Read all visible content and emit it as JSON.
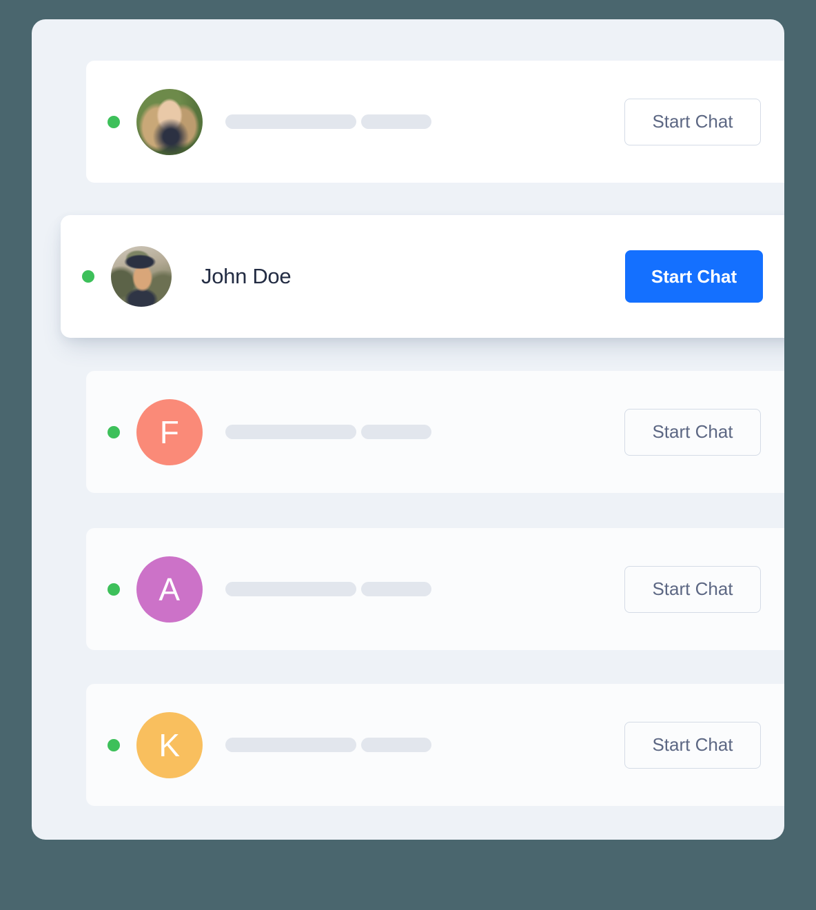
{
  "theme": {
    "page_background": "#4a666e",
    "panel_background": "#eef2f7",
    "card_background": "#ffffff",
    "primary_accent": "#1470ff",
    "status_online": "#3dc05a",
    "skeleton_gray": "#e2e6ed",
    "name_text": "#232c43",
    "outline_button_text": "#5c6783",
    "outline_button_border": "#d4dbe6"
  },
  "contacts": [
    {
      "id": "contact-1",
      "avatar_type": "photo",
      "avatar_label": "woman-portrait-photo",
      "name": "",
      "name_visible": false,
      "status": "online",
      "button_label": "Start Chat",
      "button_style": "outline",
      "highlighted": false
    },
    {
      "id": "contact-2",
      "avatar_type": "photo",
      "avatar_label": "man-with-cap-photo",
      "name": "John Doe",
      "name_visible": true,
      "status": "online",
      "button_label": "Start Chat",
      "button_style": "primary",
      "highlighted": true
    },
    {
      "id": "contact-3",
      "avatar_type": "initial",
      "avatar_label": "F",
      "avatar_color": "#fa8a78",
      "name": "",
      "name_visible": false,
      "status": "online",
      "button_label": "Start Chat",
      "button_style": "outline",
      "highlighted": false
    },
    {
      "id": "contact-4",
      "avatar_type": "initial",
      "avatar_label": "A",
      "avatar_color": "#cc72c8",
      "name": "",
      "name_visible": false,
      "status": "online",
      "button_label": "Start Chat",
      "button_style": "outline",
      "highlighted": false
    },
    {
      "id": "contact-5",
      "avatar_type": "initial",
      "avatar_label": "K",
      "avatar_color": "#f9bf5e",
      "name": "",
      "name_visible": false,
      "status": "online",
      "button_label": "Start Chat",
      "button_style": "outline",
      "highlighted": false
    }
  ]
}
